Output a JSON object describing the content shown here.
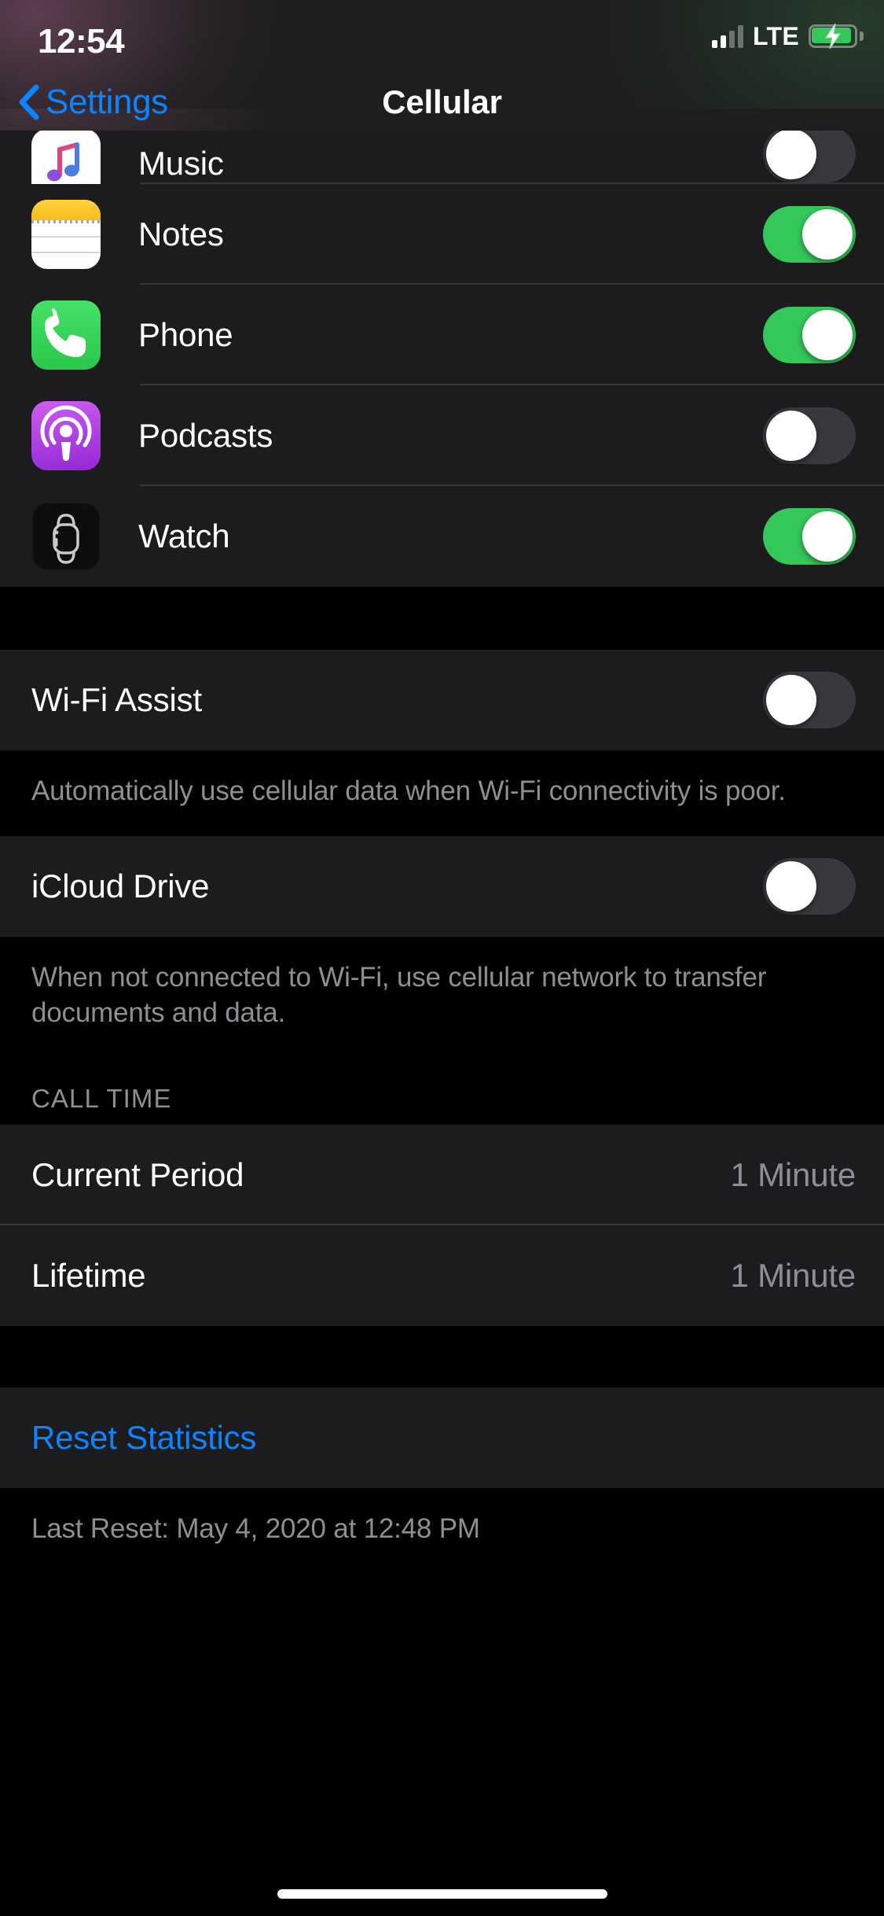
{
  "status_bar": {
    "time": "12:54",
    "network_type": "LTE",
    "signal_bars_filled": 2,
    "signal_bars_total": 4,
    "battery_charging": true,
    "battery_color": "#34c759"
  },
  "nav": {
    "back_label": "Settings",
    "title": "Cellular",
    "accent_color": "#0a84ff"
  },
  "apps": [
    {
      "name": "Music",
      "icon": "music-icon",
      "enabled": false
    },
    {
      "name": "Notes",
      "icon": "notes-icon",
      "enabled": true
    },
    {
      "name": "Phone",
      "icon": "phone-icon",
      "enabled": true
    },
    {
      "name": "Podcasts",
      "icon": "podcasts-icon",
      "enabled": false
    },
    {
      "name": "Watch",
      "icon": "watch-icon",
      "enabled": true
    }
  ],
  "wifi_assist": {
    "label": "Wi-Fi Assist",
    "enabled": false,
    "footer": "Automatically use cellular data when Wi-Fi connectivity is poor."
  },
  "icloud_drive": {
    "label": "iCloud Drive",
    "enabled": false,
    "footer": "When not connected to Wi-Fi, use cellular network to transfer documents and data."
  },
  "call_time": {
    "header": "CALL TIME",
    "rows": [
      {
        "label": "Current Period",
        "value": "1 Minute"
      },
      {
        "label": "Lifetime",
        "value": "1 Minute"
      }
    ]
  },
  "reset": {
    "label": "Reset Statistics",
    "last_reset": "Last Reset: May 4, 2020 at 12:48 PM"
  },
  "colors": {
    "toggle_on": "#34c759",
    "toggle_off": "#39393d",
    "row_bg": "#1c1c1e",
    "page_bg": "#000000",
    "secondary_text": "#8e8e93"
  }
}
